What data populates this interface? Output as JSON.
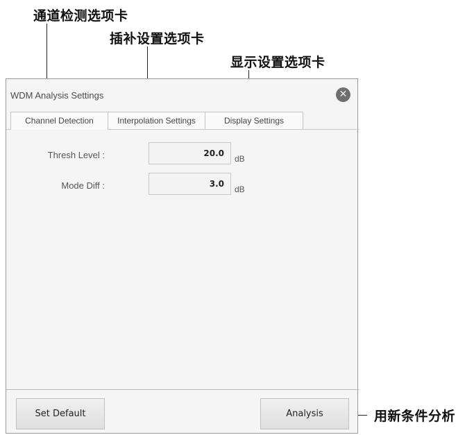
{
  "callouts": {
    "channel_tab": "通道检测选项卡",
    "interp_tab": "插补设置选项卡",
    "display_tab": "显示设置选项卡",
    "analysis_btn": "用新条件分析"
  },
  "dialog": {
    "title": "WDM Analysis Settings",
    "close_icon": "✕"
  },
  "tabs": [
    {
      "label": "Channel Detection",
      "active": true
    },
    {
      "label": "Interpolation Settings",
      "active": false
    },
    {
      "label": "Display Settings",
      "active": false
    }
  ],
  "fields": [
    {
      "label": "Thresh Level :",
      "value": "20.0",
      "unit": "dB"
    },
    {
      "label": "Mode Diff :",
      "value": "3.0",
      "unit": "dB"
    }
  ],
  "buttons": {
    "set_default": "Set Default",
    "analysis": "Analysis"
  }
}
